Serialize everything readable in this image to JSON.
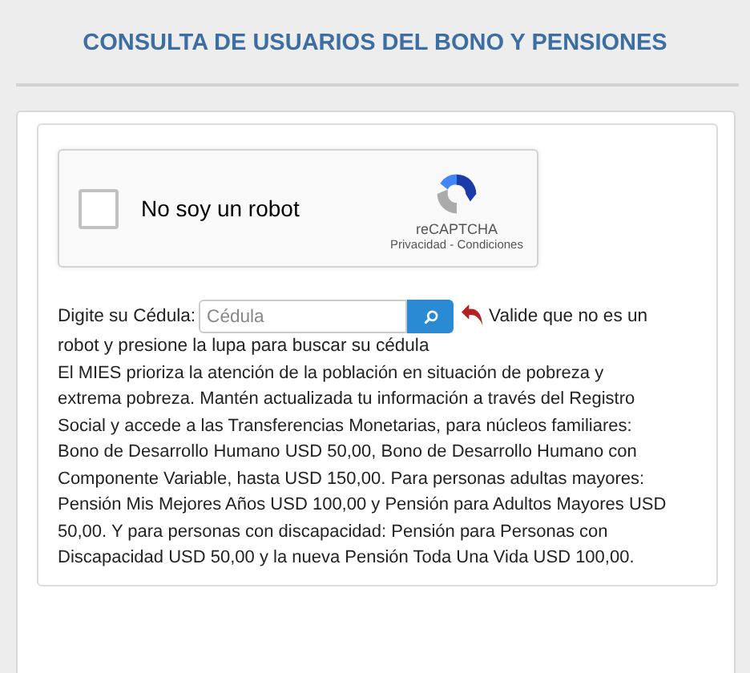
{
  "title": "CONSULTA DE USUARIOS DEL BONO Y PENSIONES",
  "captcha": {
    "label": "No soy un robot",
    "checked": false,
    "brand": "reCAPTCHA",
    "links": "Privacidad - Condiciones"
  },
  "search": {
    "label": "Digite su Cédula:",
    "placeholder": "Cédula",
    "hint": "Valide que no es un",
    "hint_continued": "robot y presione la lupa para buscar su cédula"
  },
  "info": "El MIES prioriza la atención de la población en situación de pobreza y extrema pobreza. Mantén actualizada tu información a través del Registro Social y accede a las Transferencias Monetarias, para núcleos familiares: Bono de Desarrollo Humano USD 50,00, Bono de Desarrollo Humano con Componente Variable, hasta USD 150,00. Para personas adultas mayores: Pensión Mis Mejores Años USD 100,00 y Pensión para Adultos Mayores USD 50,00. Y para personas con discapacidad: Pensión para Personas con Discapacidad USD 50,00 y la nueva Pensión Toda Una Vida USD 100,00."
}
